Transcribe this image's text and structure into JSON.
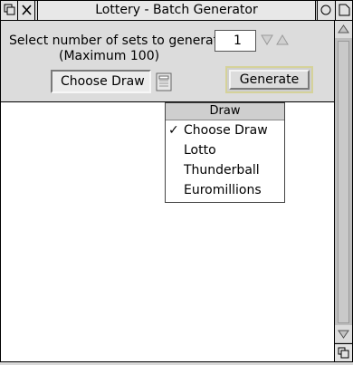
{
  "window": {
    "title": "Lottery - Batch Generator"
  },
  "form": {
    "select_label": "Select number of sets to generate",
    "max_label": "(Maximum 100)",
    "count_value": "1",
    "draw_value": "Choose Draw",
    "generate_label": "Generate"
  },
  "menu": {
    "title": "Draw",
    "tick": "✓",
    "items": [
      {
        "label": "Choose Draw",
        "checked": true
      },
      {
        "label": "Lotto",
        "checked": false
      },
      {
        "label": "Thunderball",
        "checked": false
      },
      {
        "label": "Euromillions",
        "checked": false
      }
    ]
  },
  "icons": {
    "back": "back-icon",
    "close": "close-icon",
    "iconise": "iconise-icon",
    "toggle_size": "toggle-size-icon",
    "decrement": "down-arrow-icon",
    "increment": "up-arrow-icon",
    "menu": "menu-icon",
    "scroll_up": "scroll-up-icon",
    "scroll_down": "scroll-down-icon",
    "resize": "resize-icon"
  },
  "colors": {
    "pane": "#dcdcdc",
    "default_button_ring": "#d5d29a",
    "menu_title": "#cfcfcf"
  }
}
